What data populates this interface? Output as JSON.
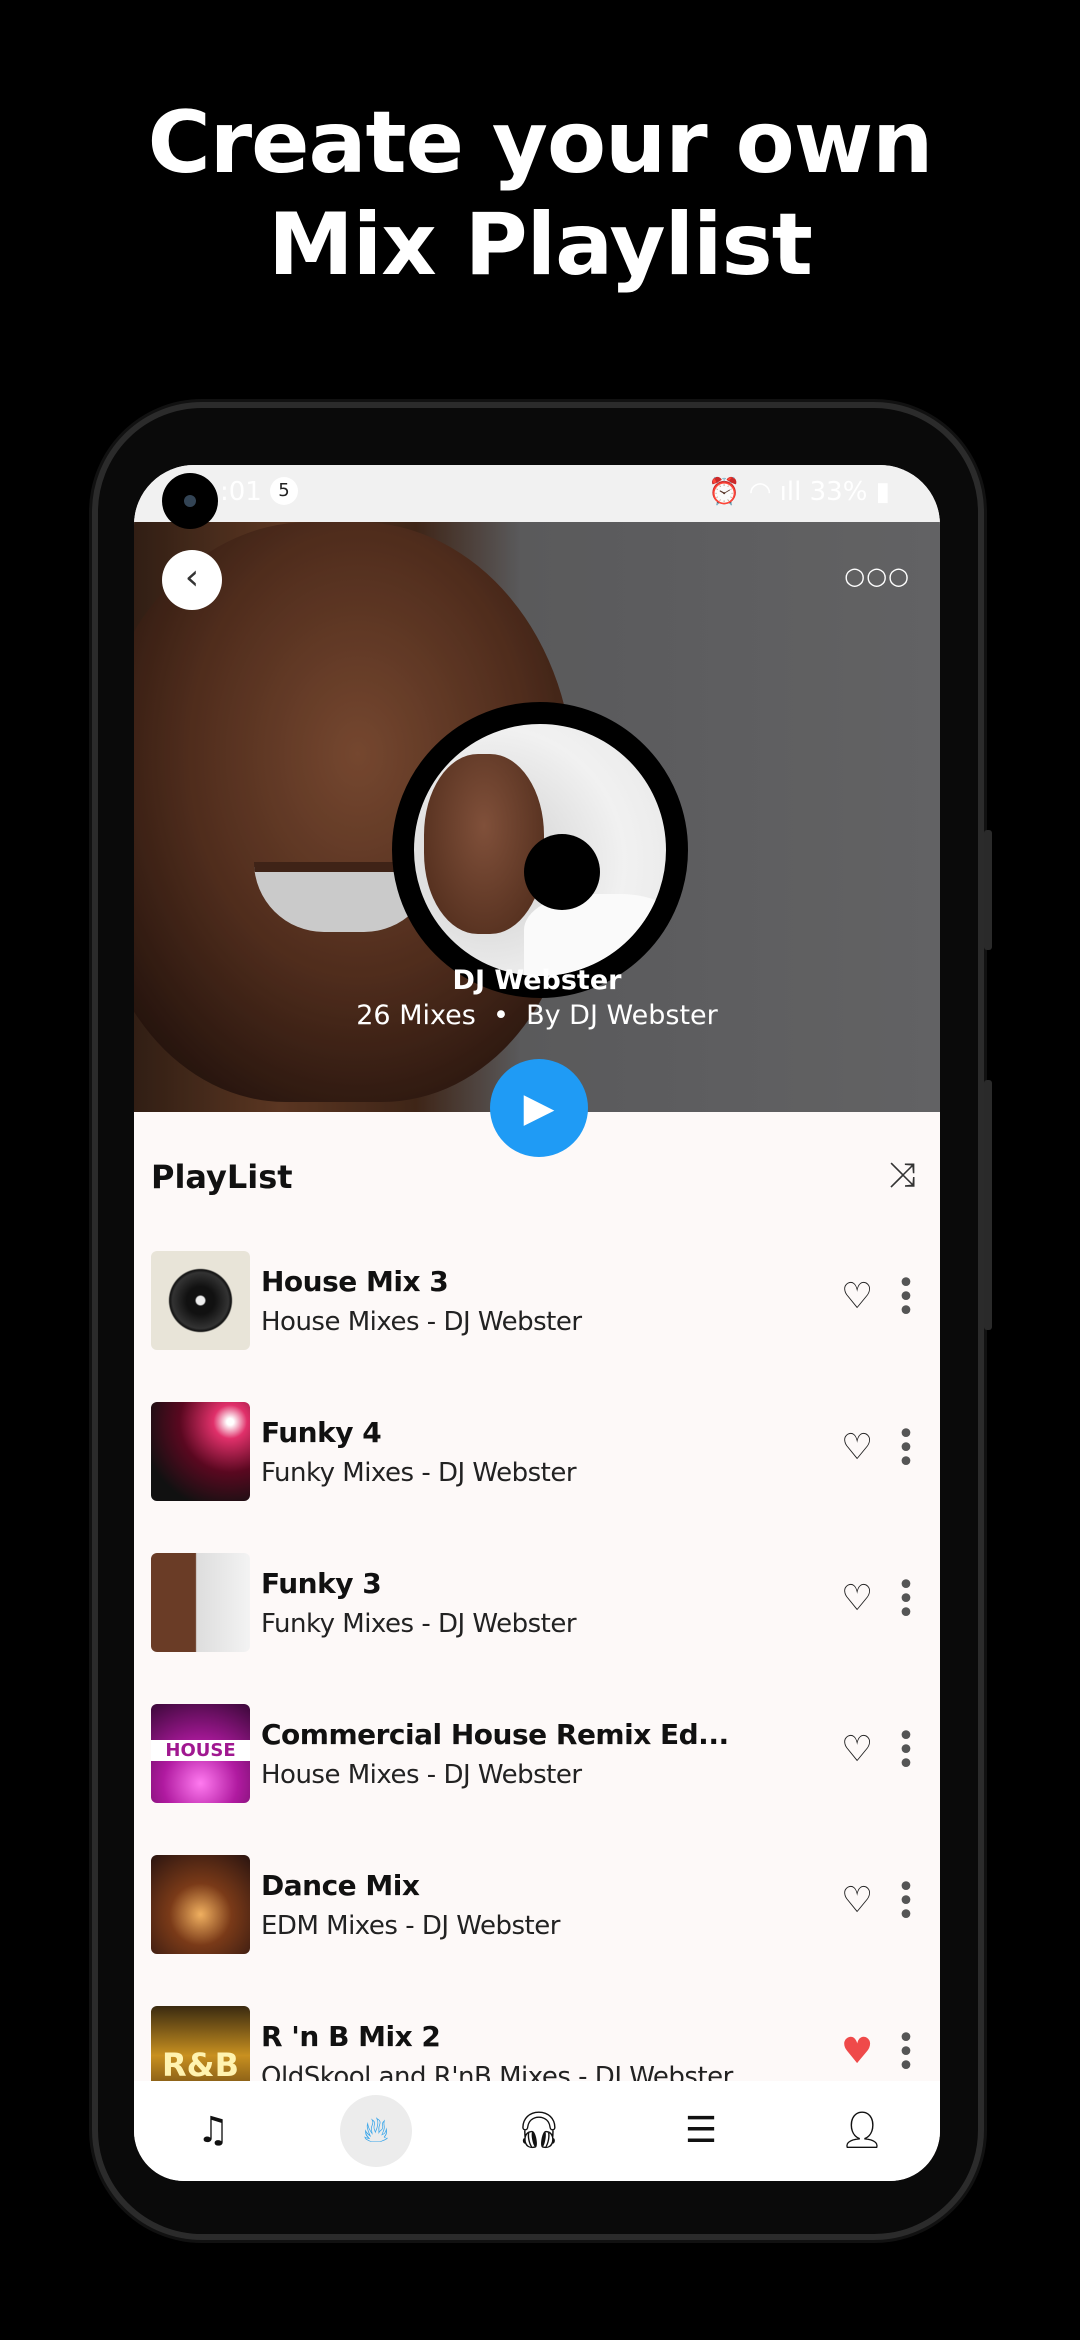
{
  "promo": {
    "line1": "Create your own",
    "line2": "Mix Playlist"
  },
  "status_bar": {
    "time": ":01",
    "notification_count": "5",
    "battery": "33%"
  },
  "header": {
    "back_icon": "chevron-left-icon",
    "more_icon": "more-horizontal-icon"
  },
  "artist": {
    "name": "DJ Webster",
    "mix_count": "26 Mixes",
    "separator": "•",
    "by": "By DJ Webster"
  },
  "playlist": {
    "title": "PlayList",
    "accent": "#1f9bf5",
    "items": [
      {
        "title": "House Mix 3",
        "subtitle": "House Mixes - DJ Webster",
        "liked": false
      },
      {
        "title": "Funky 4",
        "subtitle": "Funky Mixes - DJ Webster",
        "liked": false
      },
      {
        "title": "Funky 3",
        "subtitle": "Funky Mixes - DJ Webster",
        "liked": false
      },
      {
        "title": "Commercial House Remix Ed...",
        "subtitle": "House Mixes - DJ Webster",
        "liked": false
      },
      {
        "title": "Dance Mix",
        "subtitle": "EDM Mixes - DJ Webster",
        "liked": false
      },
      {
        "title": "R 'n B Mix 2",
        "subtitle": "OldSkool and R'nB Mixes - DJ Webster",
        "liked": true
      }
    ],
    "thumb_text": {
      "house": "HOUSE",
      "rnb": "R&B"
    }
  },
  "nav": {
    "items": [
      "music-library-icon",
      "flame-icon",
      "headphones-icon",
      "playlist-icon",
      "profile-icon"
    ],
    "active_index": 1
  }
}
